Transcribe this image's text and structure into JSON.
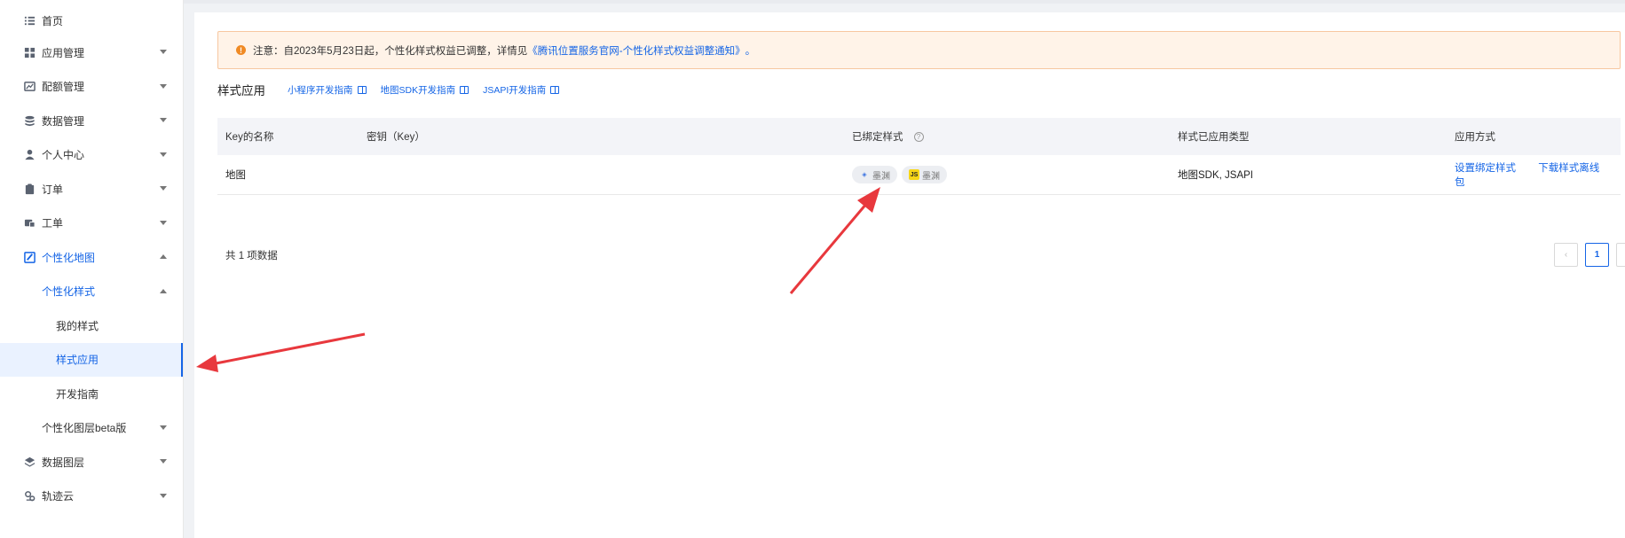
{
  "sidebar": {
    "items": [
      {
        "label": "首页",
        "icon": "list-icon"
      },
      {
        "label": "应用管理",
        "icon": "grid-icon"
      },
      {
        "label": "配额管理",
        "icon": "chart-icon"
      },
      {
        "label": "数据管理",
        "icon": "database-icon"
      },
      {
        "label": "个人中心",
        "icon": "user-icon"
      },
      {
        "label": "订单",
        "icon": "clipboard-icon"
      },
      {
        "label": "工单",
        "icon": "ticket-icon"
      },
      {
        "label": "个性化地图",
        "icon": "map-edit-icon"
      },
      {
        "label": "个性化样式"
      },
      {
        "label": "我的样式"
      },
      {
        "label": "样式应用"
      },
      {
        "label": "开发指南"
      },
      {
        "label": "个性化图层beta版"
      },
      {
        "label": "数据图层",
        "icon": "layers-icon"
      },
      {
        "label": "轨迹云",
        "icon": "track-icon"
      }
    ]
  },
  "notice": {
    "prefix": "注意：自2023年5月23日起，个性化样式权益已调整，详情见",
    "link": "《腾讯位置服务官网-个性化样式权益调整通知》",
    "suffix": "。"
  },
  "section": {
    "title": "样式应用",
    "links": [
      "小程序开发指南",
      "地图SDK开发指南",
      "JSAPI开发指南"
    ]
  },
  "table": {
    "headers": [
      "Key的名称",
      "密钥（Key）",
      "已绑定样式",
      "样式已应用类型",
      "应用方式"
    ],
    "rows": [
      {
        "name": "地图",
        "key": "",
        "styles": [
          "墨渊",
          "墨渊"
        ],
        "types": "地图SDK, JSAPI",
        "actions": [
          "设置绑定样式",
          "下载样式离线包"
        ]
      }
    ]
  },
  "footer": {
    "total": "共 1 项数据",
    "current_page": "1",
    "prev": "‹",
    "next": "›"
  },
  "colors": {
    "accent": "#1565e6",
    "arrow": "#e8383d",
    "notice_bg": "#fff3e8"
  }
}
